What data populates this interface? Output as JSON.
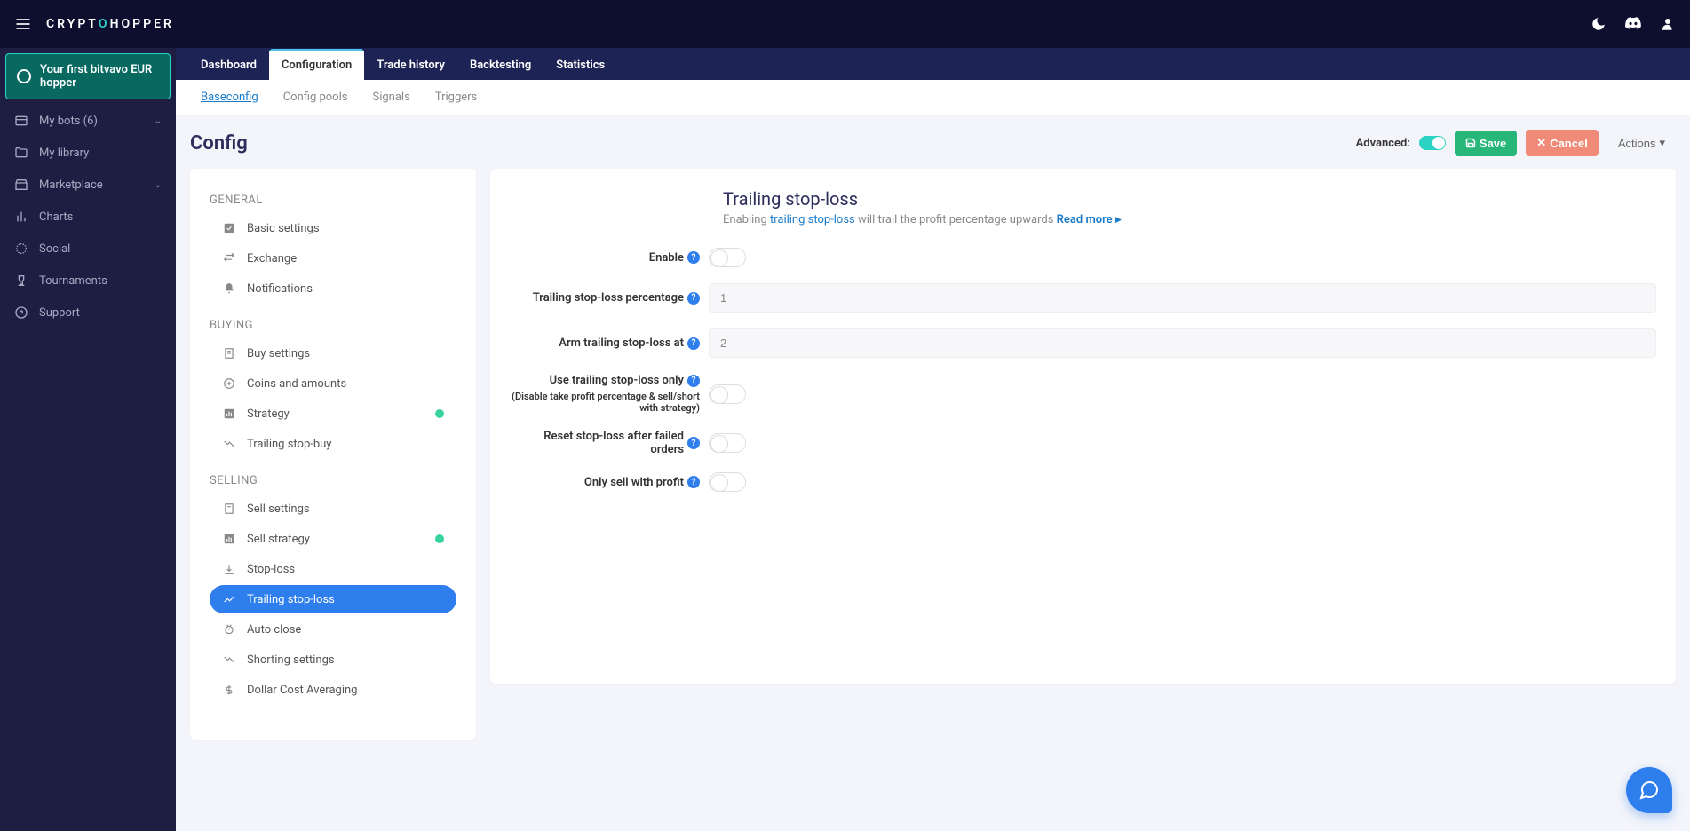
{
  "brand": "CRYPTOHOPPER",
  "hopper_name": "Your first bitvavo EUR hopper",
  "sidebar": {
    "items": [
      {
        "label": "My bots (6)",
        "expandable": true
      },
      {
        "label": "My library",
        "expandable": false
      },
      {
        "label": "Marketplace",
        "expandable": true
      },
      {
        "label": "Charts",
        "expandable": false
      },
      {
        "label": "Social",
        "expandable": false
      },
      {
        "label": "Tournaments",
        "expandable": false
      },
      {
        "label": "Support",
        "expandable": false
      }
    ]
  },
  "tabs": {
    "items": [
      "Dashboard",
      "Configuration",
      "Trade history",
      "Backtesting",
      "Statistics"
    ],
    "active": 1
  },
  "subtabs": {
    "items": [
      "Baseconfig",
      "Config pools",
      "Signals",
      "Triggers"
    ],
    "active": 0
  },
  "page_title": "Config",
  "header": {
    "advanced_label": "Advanced:",
    "save": "Save",
    "cancel": "Cancel",
    "actions": "Actions"
  },
  "categories": {
    "general": {
      "title": "GENERAL",
      "items": [
        "Basic settings",
        "Exchange",
        "Notifications"
      ]
    },
    "buying": {
      "title": "BUYING",
      "items": [
        "Buy settings",
        "Coins and amounts",
        "Strategy",
        "Trailing stop-buy"
      ]
    },
    "selling": {
      "title": "SELLING",
      "items": [
        "Sell settings",
        "Sell strategy",
        "Stop-loss",
        "Trailing stop-loss",
        "Auto close",
        "Shorting settings",
        "Dollar Cost Averaging"
      ]
    }
  },
  "form": {
    "title": "Trailing stop-loss",
    "desc_pre": "Enabling ",
    "desc_link": "trailing stop-loss",
    "desc_post": " will trail the profit percentage upwards ",
    "read_more": "Read more",
    "enable_label": "Enable",
    "tsl_pct_label": "Trailing stop-loss percentage",
    "tsl_pct_value": "1",
    "arm_label": "Arm trailing stop-loss at",
    "arm_value": "2",
    "only_label": "Use trailing stop-loss only",
    "only_sublabel": "(Disable take profit percentage & sell/short with strategy)",
    "reset_label": "Reset stop-loss after failed orders",
    "profit_label": "Only sell with profit"
  }
}
